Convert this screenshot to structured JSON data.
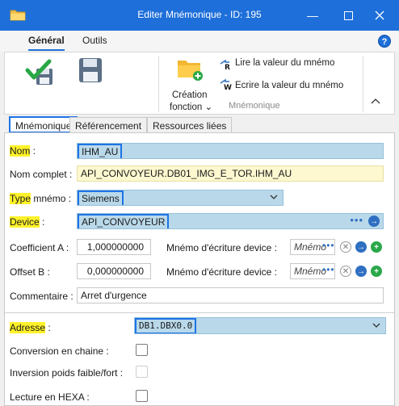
{
  "window": {
    "title": "Editer Mnémonique - ID: 195"
  },
  "ribbon": {
    "tabs": [
      "Général",
      "Outils"
    ],
    "help_label": "?",
    "creation_label_line1": "Création",
    "creation_label_line2": "fonction ⌄",
    "read_label": "Lire la valeur du mnémo",
    "write_label": "Ecrire la valeur du mnémo",
    "group_label": "Mnémonique"
  },
  "doc_tabs": [
    "Mnémonique",
    "Référencement",
    "Ressources liées"
  ],
  "form": {
    "nom_label": "Nom",
    "nom_value": "IHM_AU",
    "nom_complet_label": "Nom complet :",
    "nom_complet_value": "API_CONVOYEUR.DB01_IMG_E_TOR.IHM_AU",
    "type_label": "Type",
    "type_label_rest": " mnémo :",
    "type_value": "Siemens",
    "device_label": "Device",
    "device_value": "API_CONVOYEUR",
    "coef_label": "Coefficient A :",
    "coef_value": "1,000000000",
    "coef_mnemo_label": "Mnémo d'écriture device :",
    "coef_mnemo_placeholder": "Mnémo",
    "offset_label": "Offset B :",
    "offset_value": "0,000000000",
    "offset_mnemo_label": "Mnémo d'écriture device :",
    "offset_mnemo_placeholder": "Mnémo",
    "comment_label": "Commentaire :",
    "comment_value": "Arret d'urgence",
    "adresse_label": "Adresse",
    "adresse_value": "DB1.DBX0.0",
    "conv_label": "Conversion en chaine :",
    "inversion_label": "Inversion poids faible/fort :",
    "hexa_label": "Lecture en HEXA :"
  },
  "colors": {
    "titlebar": "#1e6fd9",
    "field_blue": "#b9d9ea",
    "field_yellow": "#fdf8cf",
    "highlight": "#fff22a",
    "focus_border": "#1e73e6"
  },
  "icons": [
    "folder-icon",
    "minimize-icon",
    "maximize-icon",
    "close-icon",
    "help-icon",
    "checkmark-save-icon",
    "save-disk-icon",
    "folder-add-icon",
    "read-value-icon",
    "write-value-icon",
    "chevron-up-icon",
    "chevron-down-icon",
    "dots-icon",
    "arrow-right-icon",
    "clear-icon",
    "add-icon"
  ]
}
